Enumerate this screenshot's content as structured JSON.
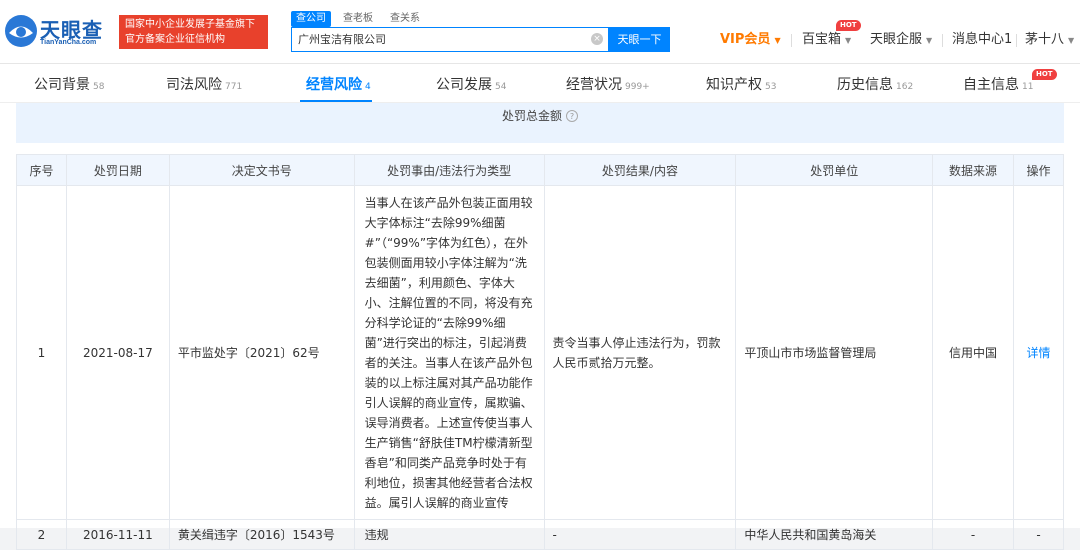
{
  "header": {
    "logo_text": "天眼查",
    "logo_sub": "TianYanCha.com",
    "banner_line1": "国家中小企业发展子基金旗下",
    "banner_line2": "官方备案企业征信机构",
    "search_tabs": [
      "查公司",
      "查老板",
      "查关系"
    ],
    "search_value": "广州宝洁有限公司",
    "search_clear": "×",
    "search_button": "天眼一下",
    "nav": {
      "vip": "VIP会员",
      "baibao": "百宝箱",
      "qibao": "天眼企服",
      "messages": "消息中心1",
      "user": "茅十八",
      "hot": "HOT"
    }
  },
  "tabs": [
    {
      "label": "公司背景",
      "count": "58"
    },
    {
      "label": "司法风险",
      "count": "771"
    },
    {
      "label": "经营风险",
      "count": "4"
    },
    {
      "label": "公司发展",
      "count": "54"
    },
    {
      "label": "经营状况",
      "count": "999+"
    },
    {
      "label": "知识产权",
      "count": "53"
    },
    {
      "label": "历史信息",
      "count": "162"
    },
    {
      "label": "自主信息",
      "count": "11"
    }
  ],
  "tabs_hot": "HOT",
  "summary": {
    "label": "处罚总金额",
    "help": "?"
  },
  "table": {
    "headers": [
      "序号",
      "处罚日期",
      "决定文书号",
      "处罚事由/违法行为类型",
      "处罚结果/内容",
      "处罚单位",
      "数据来源",
      "操作"
    ],
    "rows": [
      {
        "index": "1",
        "date": "2021-08-17",
        "doc_no": "平市监处字〔2021〕62号",
        "reason": "当事人在该产品外包装正面用较大字体标注“去除99%细菌#”（“99%”字体为红色），在外包装侧面用较小字体注解为“洗去细菌”，利用颜色、字体大小、注解位置的不同，将没有充分科学论证的“去除99%细菌”进行突出的标注，引起消费者的关注。当事人在该产品外包装的以上标注属对其产品功能作引人误解的商业宣传，属欺骗、误导消费者。上述宣传使当事人生产销售“舒肤佳TM柠檬清新型香皂”和同类产品竞争时处于有利地位，损害其他经营者合法权益。属引人误解的商业宣传",
        "result": "责令当事人停止违法行为，罚款人民币贰拾万元整。",
        "authority": "平顶山市市场监督管理局",
        "source": "信用中国",
        "action": "详情"
      },
      {
        "index": "2",
        "date": "2016-11-11",
        "doc_no": "黄关缉违字〔2016〕1543号",
        "reason": "违规",
        "result": "-",
        "authority": "中华人民共和国黄岛海关",
        "source": "-",
        "action": "-"
      }
    ]
  }
}
